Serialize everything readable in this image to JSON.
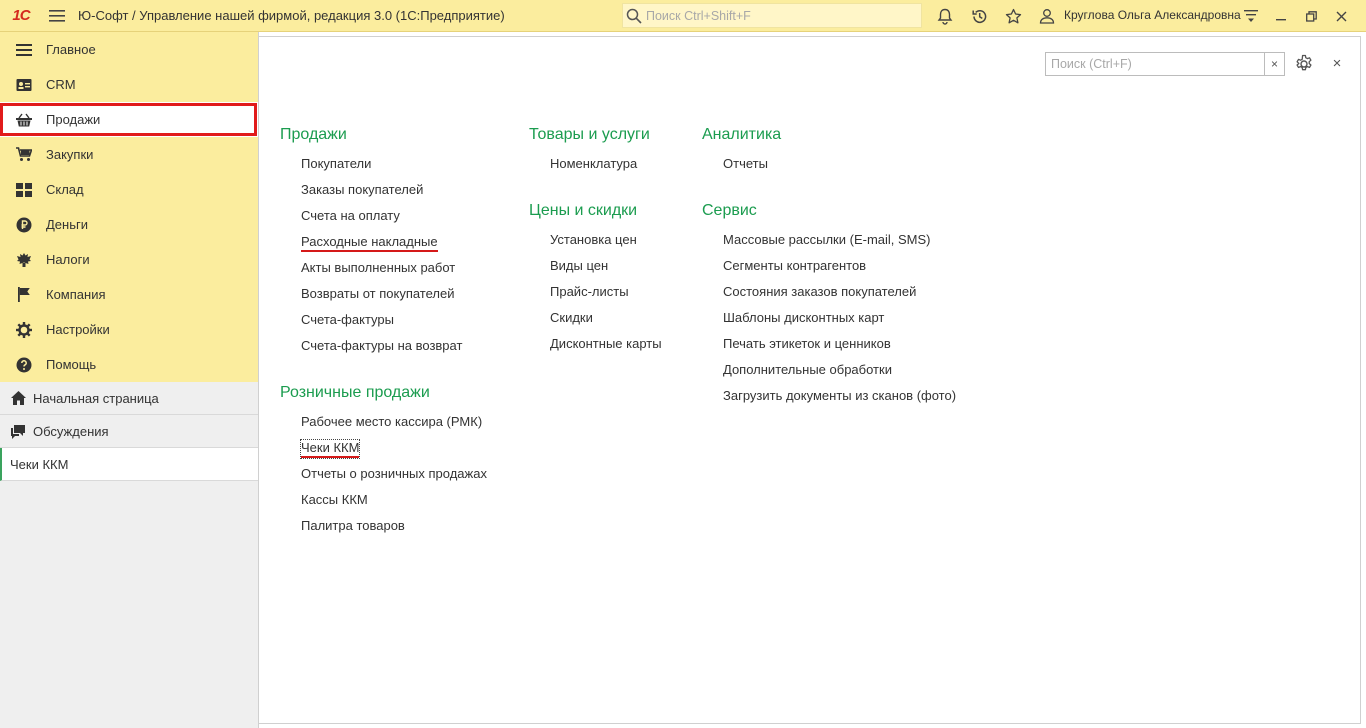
{
  "titlebar": {
    "logo": "1С",
    "title": "Ю-Софт / Управление нашей фирмой, редакция 3.0  (1С:Предприятие)",
    "search_placeholder": "Поиск Ctrl+Shift+F",
    "user": "Круглова Ольга Александровна"
  },
  "sidebar": {
    "sections": [
      {
        "label": "Главное",
        "icon": "menu-lines-icon"
      },
      {
        "label": "CRM",
        "icon": "contact-card-icon"
      },
      {
        "label": "Продажи",
        "icon": "basket-icon"
      },
      {
        "label": "Закупки",
        "icon": "cart-icon"
      },
      {
        "label": "Склад",
        "icon": "warehouse-grid-icon"
      },
      {
        "label": "Деньги",
        "icon": "ruble-coin-icon"
      },
      {
        "label": "Налоги",
        "icon": "eagle-emblem-icon"
      },
      {
        "label": "Компания",
        "icon": "flag-icon"
      },
      {
        "label": "Настройки",
        "icon": "gear-icon"
      },
      {
        "label": "Помощь",
        "icon": "help-icon"
      }
    ],
    "home": "Начальная страница",
    "discussions": "Обсуждения",
    "open_window": "Чеки ККМ"
  },
  "form": {
    "search_placeholder": "Поиск (Ctrl+F)",
    "clear": "×",
    "close": "×"
  },
  "columns": {
    "sales": {
      "title": "Продажи",
      "links": [
        "Покупатели",
        "Заказы покупателей",
        "Счета на оплату",
        "Расходные накладные",
        "Акты выполненных работ",
        "Возвраты от покупателей",
        "Счета-фактуры",
        "Счета-фактуры на возврат"
      ]
    },
    "retail": {
      "title": "Розничные продажи",
      "links": [
        "Рабочее место кассира (РМК)",
        "Чеки ККМ",
        "Отчеты о розничных продажах",
        "Кассы ККМ",
        "Палитра товаров"
      ]
    },
    "goods": {
      "title": "Товары и услуги",
      "links": [
        "Номенклатура"
      ]
    },
    "prices": {
      "title": "Цены и скидки",
      "links": [
        "Установка цен",
        "Виды цен",
        "Прайс-листы",
        "Скидки",
        "Дисконтные карты"
      ]
    },
    "analytics": {
      "title": "Аналитика",
      "links": [
        "Отчеты"
      ]
    },
    "service": {
      "title": "Сервис",
      "links": [
        "Массовые рассылки (E-mail, SMS)",
        "Сегменты контрагентов",
        "Состояния заказов покупателей",
        "Шаблоны дисконтных карт",
        "Печать этикеток и ценников",
        "Дополнительные обработки",
        "Загрузить документы из сканов (фото)"
      ]
    }
  },
  "colors": {
    "titlebar": "#fbed9e",
    "group_title": "#1b9c4f",
    "highlight": "#e11b1b"
  }
}
